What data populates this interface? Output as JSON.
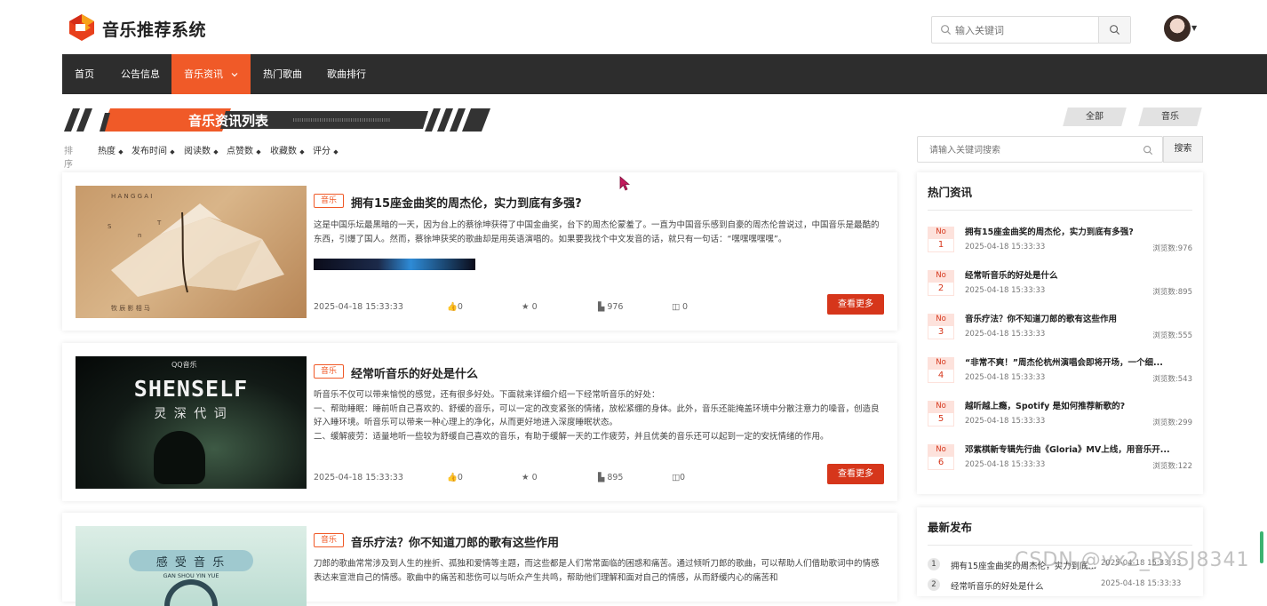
{
  "header": {
    "brand": "音乐推荐系统",
    "search_placeholder": "输入关键词"
  },
  "nav": {
    "items": [
      {
        "label": "首页"
      },
      {
        "label": "公告信息"
      },
      {
        "label": "音乐资讯",
        "active": true
      },
      {
        "label": "热门歌曲"
      },
      {
        "label": "歌曲排行"
      }
    ]
  },
  "section": {
    "title": "音乐资讯列表",
    "filters": [
      "全部",
      "音乐"
    ]
  },
  "sort": {
    "label": "排序",
    "items": [
      "热度",
      "发布时间",
      "阅读数",
      "点赞数",
      "收藏数",
      "评分"
    ]
  },
  "side_search": {
    "placeholder": "请输入关键词搜索",
    "button": "搜索"
  },
  "articles": [
    {
      "tag": "音乐",
      "title": "拥有15座金曲奖的周杰伦，实力到底有多强?",
      "desc": "这是中国乐坛最黑暗的一天，因为台上的蔡徐坤获得了中国金曲奖，台下的周杰伦蒙羞了。一直为中国音乐感到自豪的周杰伦曾说过，中国音乐是最酷的东西，引爆了国人。然而，蔡徐坤获奖的歌曲却是用英语演唱的。如果要我找个中文发音的话，就只有一句话：“嘿嘿嘿嘿嘿”。",
      "date": "2025-04-18 15:33:33",
      "likes": "0",
      "favorites": "0",
      "views": "976",
      "comments": "0",
      "button": "查看更多"
    },
    {
      "tag": "音乐",
      "title": "经常听音乐的好处是什么",
      "desc": "听音乐不仅可以带来愉悦的感觉，还有很多好处。下面就来详细介绍一下经常听音乐的好处：\n一、帮助睡眠：睡前听自己喜欢的、舒缓的音乐，可以一定的改变紧张的情绪，放松紧绷的身体。此外，音乐还能掩盖环境中分散注意力的噪音，创造良好入睡环境。听音乐可以带来一种心理上的净化，从而更好地进入深度睡眠状态。\n二、缓解疲劳：适量地听一些较为舒缓自己喜欢的音乐，有助于缓解一天的工作疲劳，并且优美的音乐还可以起到一定的安抚情绪的作用。",
      "date": "2025-04-18 15:33:33",
      "likes": "0",
      "favorites": "0",
      "views": "895",
      "comments": "0",
      "button": "查看更多",
      "thumb_text": "SHENSELF",
      "thumb_sub": "灵 深   代 词",
      "thumb_brand": "QQ音乐"
    },
    {
      "tag": "音乐",
      "title": "音乐疗法？你不知道刀郎的歌有这些作用",
      "desc": "刀郎的歌曲常常涉及到人生的挫折、孤独和爱情等主题，而这些都是人们常常面临的困惑和痛苦。通过倾听刀郎的歌曲，可以帮助人们借助歌词中的情感表达来宣泄自己的情感。歌曲中的痛苦和悲伤可以与听众产生共鸣，帮助他们理解和面对自己的情感，从而舒缓内心的痛苦和",
      "thumb_text": "感 受 音 乐",
      "thumb_sub": "GAN SHOU YIN YUE"
    }
  ],
  "hot": {
    "title": "热门资讯",
    "no_label": "No",
    "views_label": "浏览数:",
    "items": [
      {
        "rank": "1",
        "title": "拥有15座金曲奖的周杰伦，实力到底有多强?",
        "date": "2025-04-18 15:33:33",
        "views": "976"
      },
      {
        "rank": "2",
        "title": "经常听音乐的好处是什么",
        "date": "2025-04-18 15:33:33",
        "views": "895"
      },
      {
        "rank": "3",
        "title": "音乐疗法？你不知道刀郎的歌有这些作用",
        "date": "2025-04-18 15:33:33",
        "views": "555"
      },
      {
        "rank": "4",
        "title": "“非常不爽！”周杰伦杭州演唱会即将开场，一个细...",
        "date": "2025-04-18 15:33:33",
        "views": "543"
      },
      {
        "rank": "5",
        "title": "越听越上瘾，Spotify 是如何推荐新歌的?",
        "date": "2025-04-18 15:33:33",
        "views": "299"
      },
      {
        "rank": "6",
        "title": "邓紫棋新专辑先行曲《Gloria》MV上线，用音乐开...",
        "date": "2025-04-18 15:33:33",
        "views": "122"
      }
    ]
  },
  "latest": {
    "title": "最新发布",
    "items": [
      {
        "rank": "1",
        "title": "拥有15座金曲奖的周杰伦，实力到底有多强?",
        "date": "2025-04-18 15:33:33"
      },
      {
        "rank": "2",
        "title": "经常听音乐的好处是什么",
        "date": "2025-04-18 15:33:33"
      }
    ]
  },
  "watermark": "CSDN @vx2_BYSJ8341"
}
